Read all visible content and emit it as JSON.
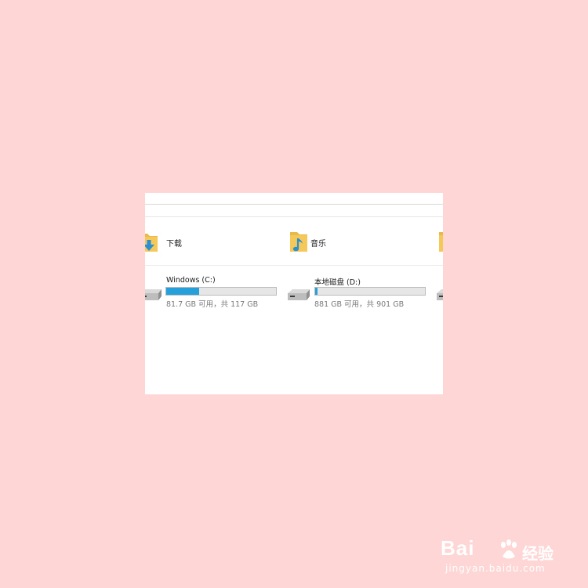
{
  "explorer": {
    "folders": [
      {
        "label": "下载",
        "icon": "download-folder-icon"
      },
      {
        "label": "音乐",
        "icon": "music-folder-icon"
      }
    ],
    "drives": [
      {
        "name": "Windows (C:)",
        "info": "81.7 GB 可用，共 117 GB",
        "used_fraction": 0.302
      },
      {
        "name": "本地磁盘 (D:)",
        "info": "881 GB 可用，共 901 GB",
        "used_fraction": 0.022
      }
    ]
  },
  "colors": {
    "background": "#ffd6d6",
    "progress_fill": "#26a0da",
    "folder_yellow": "#f5c85a",
    "accent_blue": "#2b8fd6"
  },
  "watermark": {
    "brand": "Bai",
    "brand_suffix": "经验",
    "url": "jingyan.baidu.com"
  }
}
